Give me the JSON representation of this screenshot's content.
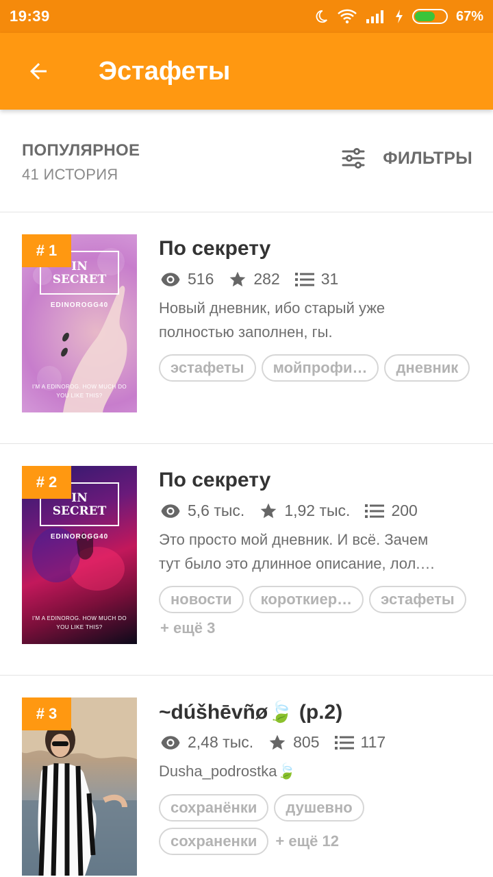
{
  "status_bar": {
    "time": "19:39",
    "battery_percent": "67%",
    "battery_level": 0.67,
    "icons": [
      "moon-icon",
      "wifi-icon",
      "signal-icon",
      "charging-icon",
      "battery-icon"
    ]
  },
  "app_bar": {
    "title": "Эстафеты",
    "back_icon": "arrow-back-icon"
  },
  "sort": {
    "title": "ПОПУЛЯРНОЕ",
    "count": "41 ИСТОРИЯ",
    "filter_label": "ФИЛЬТРЫ",
    "filter_icon": "sliders-icon"
  },
  "colors": {
    "status_bar": "#f58a0b",
    "app_bar": "#ff9811",
    "badge": "#ff9811",
    "tag_text": "#b3b3b3"
  },
  "stories": [
    {
      "rank": "# 1",
      "title": "По секрету",
      "views": "516",
      "votes": "282",
      "parts": "31",
      "description": [
        "Новый дневник, ибо старый уже",
        "полностью заполнен, гы."
      ],
      "tags": [
        "эстафеты",
        "мойпрофи…",
        "дневник"
      ],
      "more_tags": "",
      "cover": {
        "title_line1": "IN",
        "title_line2": "SECRET",
        "author": "EDINOROGG40",
        "tagline": "I'M A EDINOROG. HOW MUCH DO YOU LIKE THIS?"
      }
    },
    {
      "rank": "# 2",
      "title": "По секрету",
      "views": "5,6 тыс.",
      "votes": "1,92 тыс.",
      "parts": "200",
      "description": [
        "Это просто мой дневник. И всё. Зачем",
        "тут было это длинное описание, лол.…"
      ],
      "tags": [
        "новости",
        "короткиер…",
        "эстафеты"
      ],
      "more_tags": "+ ещё 3",
      "cover": {
        "title_line1": "IN",
        "title_line2": "SECRET",
        "author": "EDINOROGG40",
        "tagline": "I'M A EDINOROG. HOW MUCH DO YOU LIKE THIS?"
      }
    },
    {
      "rank": "# 3",
      "title": "~dúšhēvñø🍃 (p.2)",
      "views": "2,48 тыс.",
      "votes": "805",
      "parts": "117",
      "description": [
        "Dusha_podrostka🍃"
      ],
      "tags": [
        "сохранёнки",
        "душевно",
        "сохраненки"
      ],
      "more_tags": "+ ещё 12",
      "cover": {}
    }
  ]
}
